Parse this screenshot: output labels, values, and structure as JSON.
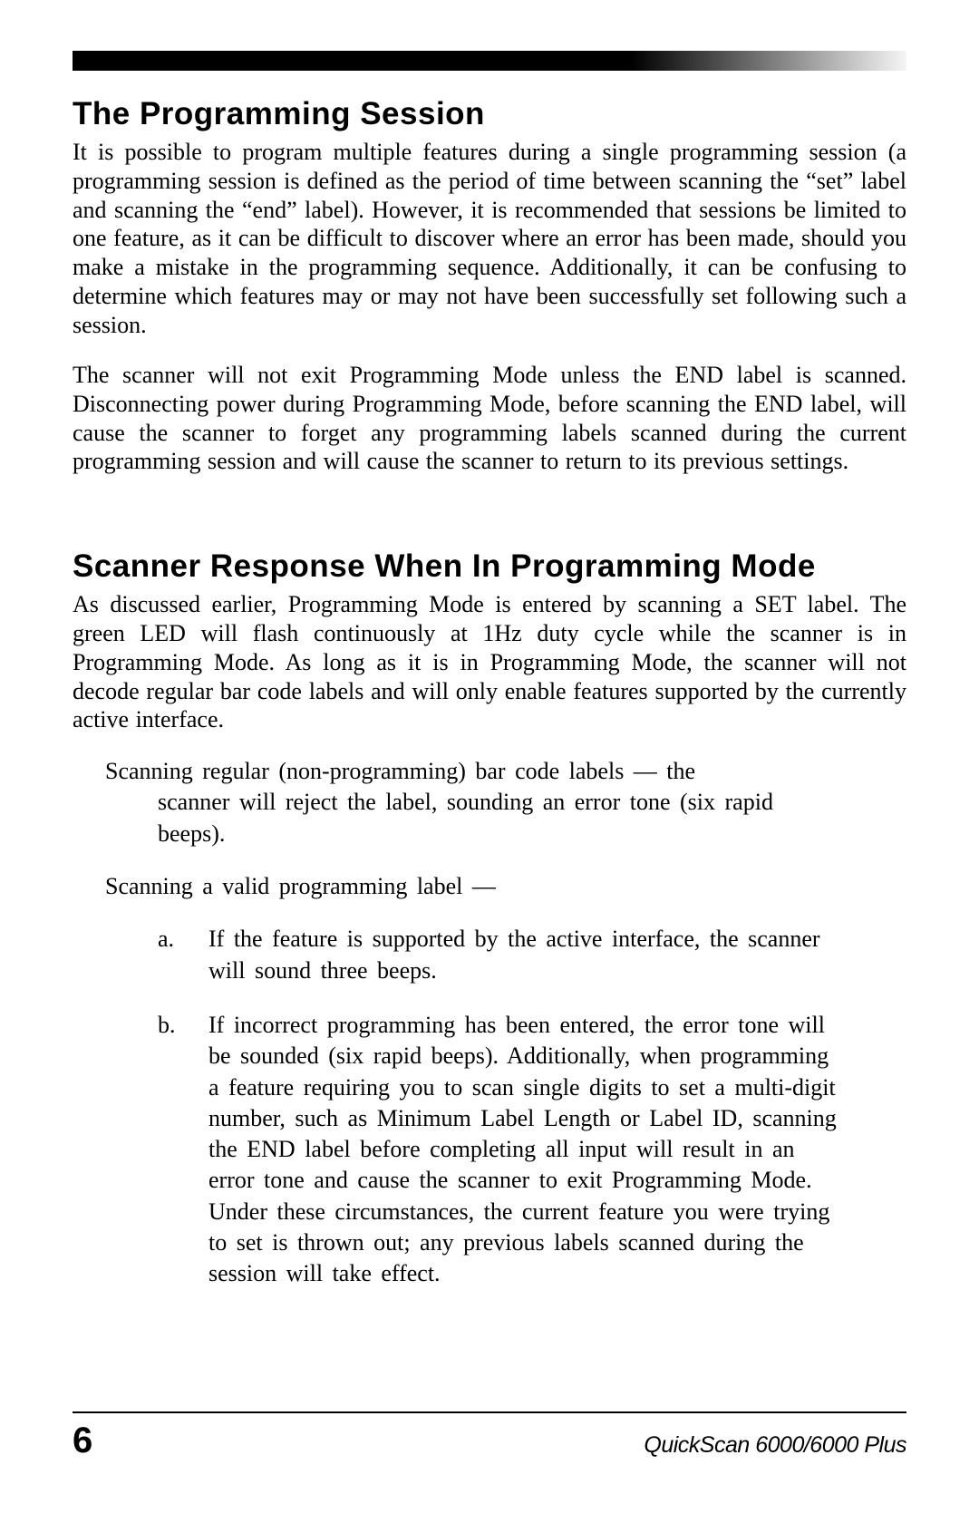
{
  "section1": {
    "heading": "The Programming Session",
    "para1": "It is possible to program multiple features during a single programming session (a programming session is defined as the period of time between scanning the “set” label and scanning the “end” label).  However, it is recommended that sessions be limited to one feature, as it can be difficult to discover where an error has been made, should you make a mistake in the programming sequence.  Additionally, it can be confusing to determine which features may or may not have been successfully set following such a session.",
    "para2": "The scanner will not exit Programming Mode unless the END label is scanned.  Disconnecting power during Programming Mode, before scanning the END label, will cause the scanner to forget any programming labels scanned during the current programming session and will cause the scanner to return to its previous settings."
  },
  "section2": {
    "heading": "Scanner Response When In Programming Mode",
    "intro": "As discussed earlier, Programming Mode is entered by scanning a SET label.  The green LED will flash continuously at 1Hz duty cycle while the scanner is in Programming Mode.  As long as it is in Programming Mode, the scanner will not decode regular bar code labels and will only enable features supported by the currently active interface.",
    "bullet1_lead": "Scanning regular (non-programming) bar code labels  —   the",
    "bullet1_rest": "scanner will reject the label, sounding an error tone (six rapid beeps).",
    "bullet2_lead": "Scanning a valid programming label  —",
    "item_a_marker": "a.",
    "item_a": "If the feature is supported by the active interface, the scanner will sound three beeps.",
    "item_b_marker": "b.",
    "item_b": "If incorrect programming has been entered, the error tone will be sounded (six rapid beeps).  Additionally, when programming a feature requiring you to scan single digits to set a multi-digit number, such as Minimum Label Length or Label ID, scanning the END label before completing all input will result in an error tone and cause the scanner to exit Programming Mode.  Under these circumstances, the current feature you were trying to set is thrown out; any previous labels scanned during the session will take effect."
  },
  "footer": {
    "page_number": "6",
    "doc_title": "QuickScan 6000/6000 Plus"
  }
}
